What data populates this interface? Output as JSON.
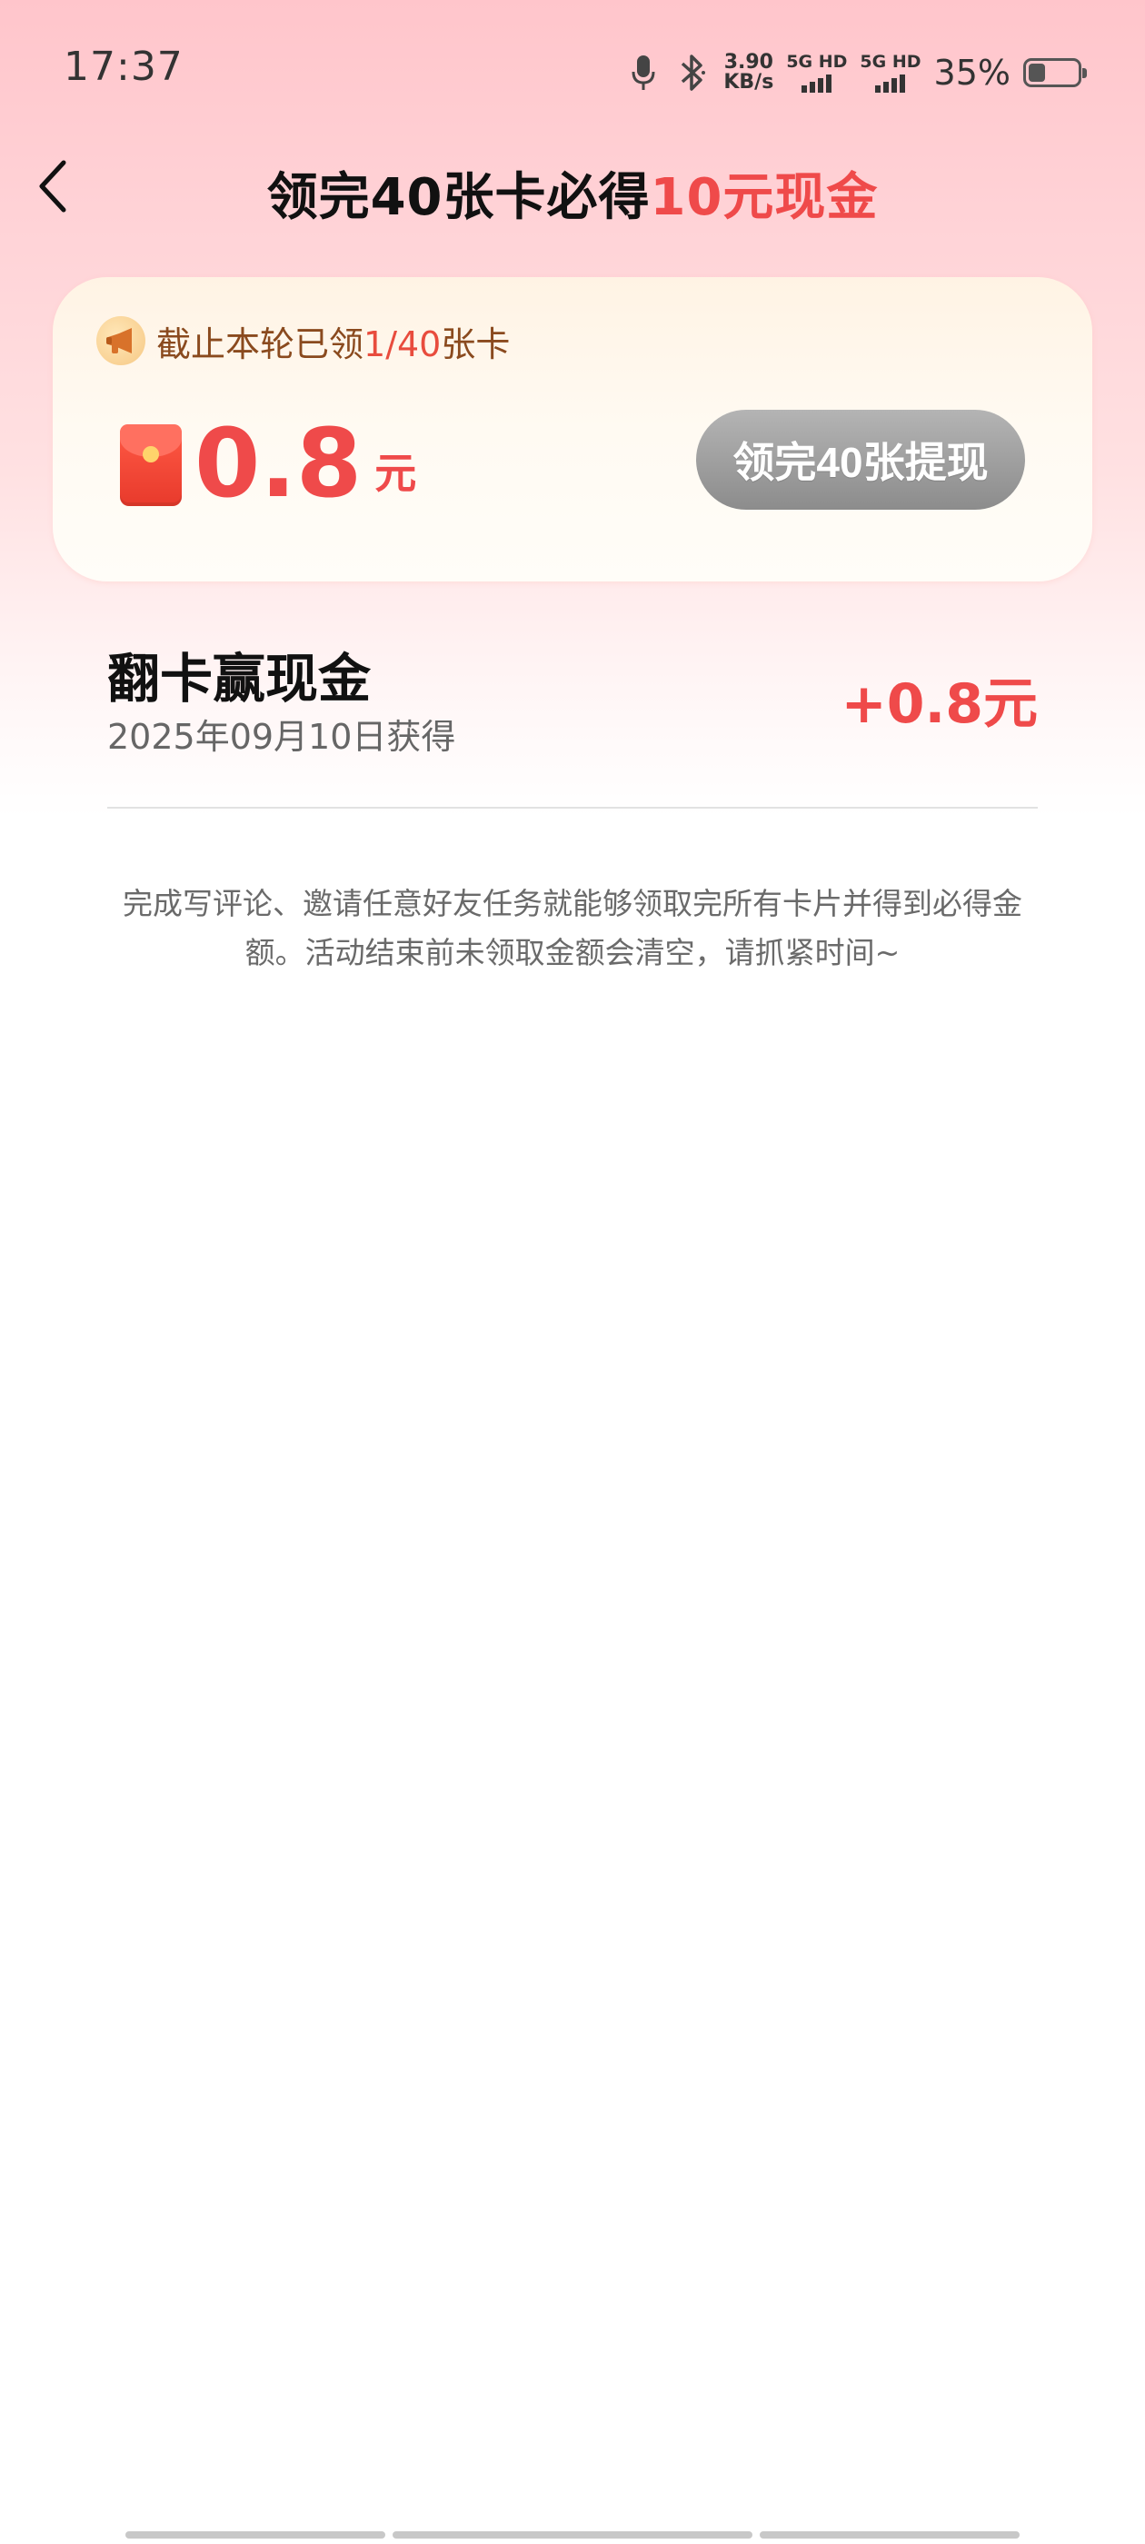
{
  "status_bar": {
    "time": "17:37",
    "net_speed_value": "3.90",
    "net_speed_unit": "KB/s",
    "sim1_label": "5G HD",
    "sim2_label": "5G HD",
    "battery_percent": "35%",
    "battery_level": 0.35,
    "icons": [
      "mic-icon",
      "bluetooth-icon",
      "signal-icon",
      "battery-icon"
    ]
  },
  "header": {
    "back_icon": "chevron-left-icon",
    "title_prefix": "领完40张卡必得",
    "title_highlight": "10元现金",
    "highlight_color": "#ef4a4a"
  },
  "card": {
    "notice_icon": "megaphone-icon",
    "notice_prefix": "截止本轮已领",
    "notice_count": "1/40",
    "notice_suffix": "张卡",
    "amount_icon": "red-packet-icon",
    "amount_value": "0.8",
    "amount_unit": "元",
    "withdraw_label": "领完40张提现"
  },
  "record": {
    "title": "翻卡赢现金",
    "date": "2025年09月10日获得",
    "amount": "+0.8元"
  },
  "footnote": "完成写评论、邀请任意好友任务就能够领取完所有卡片并得到必得金额。活动结束前未领取金额会清空，请抓紧时间~"
}
